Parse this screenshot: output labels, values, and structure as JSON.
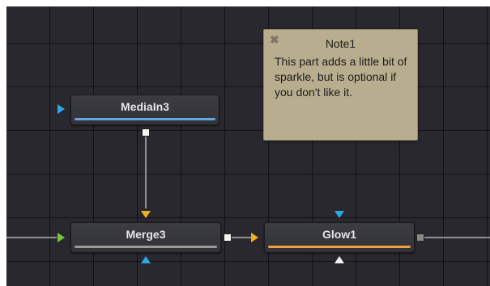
{
  "colors": {
    "blue_accent": "#5fa8e0",
    "orange_accent": "#f0a040",
    "gray_accent": "#9a9a9a",
    "input_blue": "#2aa8e8",
    "input_yellow": "#f0b020",
    "input_green": "#7cc23c",
    "input_white": "#f2f2f2",
    "output_white": "#f5f5f5",
    "output_gray": "#8a8a8a"
  },
  "nodes": {
    "mediain": {
      "label": "MediaIn3"
    },
    "merge": {
      "label": "Merge3"
    },
    "glow": {
      "label": "Glow1"
    }
  },
  "note": {
    "title": "Note1",
    "close_glyph": "✖",
    "body": "This part adds a little bit of sparkle, but is optional if you don't like it."
  },
  "icons": {
    "input_arrow": "triangle-right",
    "mask_input": "triangle-up",
    "effect_input": "triangle-down",
    "output": "square"
  }
}
